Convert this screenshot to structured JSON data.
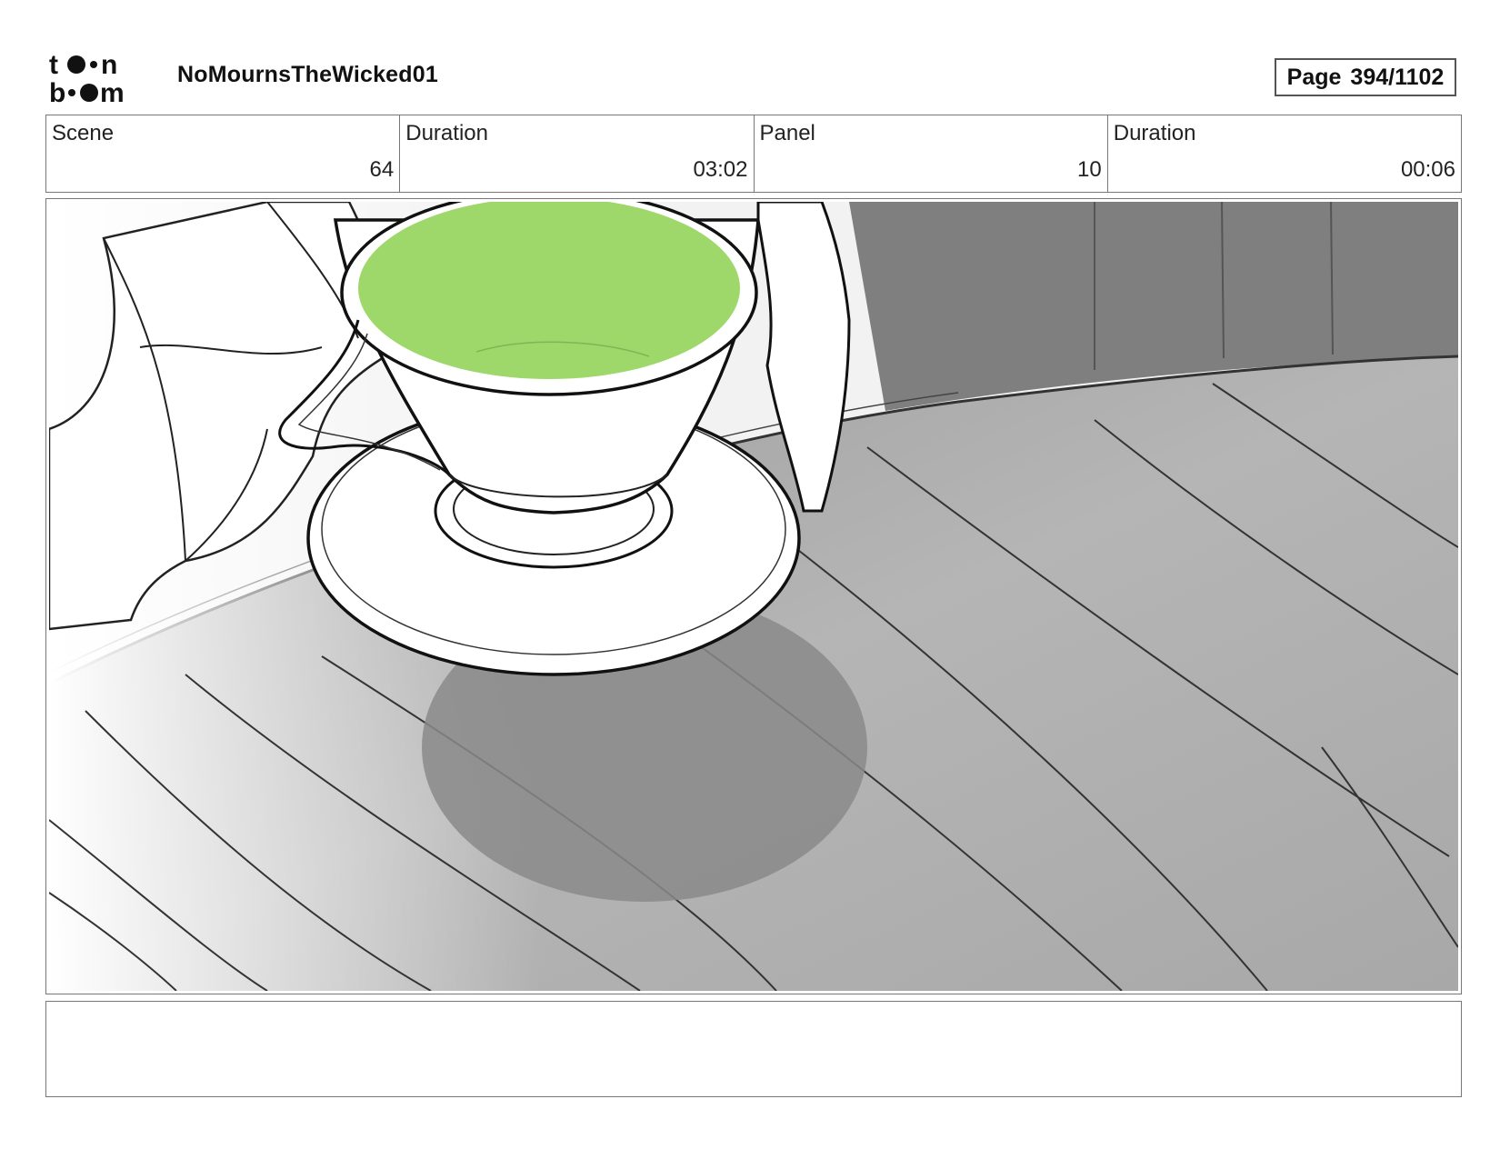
{
  "header": {
    "logo_text": "toon boom",
    "project_title": "NoMournsTheWicked01",
    "page_label": "Page",
    "page_number": "394/1102"
  },
  "info": {
    "scene_label": "Scene",
    "scene_value": "64",
    "scene_duration_label": "Duration",
    "scene_duration_value": "03:02",
    "panel_label": "Panel",
    "panel_value": "10",
    "panel_duration_label": "Duration",
    "panel_duration_value": "00:06"
  },
  "panel": {
    "liquid_color": "#9ed86a",
    "table_color": "#b3b3b3",
    "wall_color": "#7f7f7f"
  },
  "notes": {
    "text": ""
  }
}
